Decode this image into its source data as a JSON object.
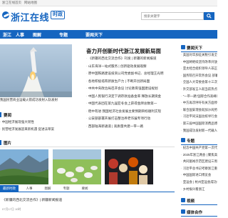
{
  "topbar": {
    "left": "浙江在线首页",
    "left2": "网站地图"
  },
  "header": {
    "logo": "浙江在线",
    "badge": "时政",
    "search_placeholder": "搜索关键字"
  },
  "nav": {
    "items": [
      "浙江",
      "人事",
      "图解",
      "专题",
      "要闻天下"
    ]
  },
  "feature": {
    "headline": "奋力开创新时代浙江发展新局面",
    "caption": "我国民营商业运载火箭成功发射入轨发射",
    "list": [
      "《新疆的西北交流合作》刊发 | 新疆的新闻报道",
      "山东海洋一站式服务 | 创新驱动发展观察",
      "原中国铁路建设投资公司党委副书记、总经理王光明",
      "各地积极培育新质生产力 | 不断开创新局面",
      "中共中央政治局召开会议 讨论教育强国建设规划",
      "中国人民银行决定下调存款准备金率 释放长期资金",
      "中国代表团在第九届亚冬会上获得金牌总数第一",
      "稳中有进 我国经济社会发展主要预期目标顺利实现",
      "公安部部署开展打击整治养老诈骗专项行动",
      "西部陆海新通道 | 高质量共建一带一路"
    ]
  },
  "focus": {
    "title": "要闻",
    "list": [
      "中国经济展现强大韧性",
      "民营经济发展迎来新机遇 促进法草案"
    ]
  },
  "gallery": {
    "title": "图片"
  },
  "tabs": {
    "items": [
      "最新时政",
      "人事",
      "图解",
      "专题",
      "要闻"
    ]
  },
  "bottom_news": {
    "headline": "《新疆的西北交流合作》| 新疆新闻报道",
    "date": "07月17日 10时"
  },
  "sidebar": {
    "hot_title": "要闻天下",
    "hot_list": [
      "美国对华加征关税引发全球市场震荡",
      "中国将继续坚持改革开放 欢迎各国企业来华投资",
      "亚太经合组织领导人非正式会议在秘鲁举行",
      "国务院召开常务会议 部署推动经济持续回升向好",
      "全国人大常委会第十三次会议闭幕",
      "外交部发言人就当前热点问题答记者问",
      "\"一带一路\"国际合作高峰论坛成果丰硕",
      "中方再次呼吁有关方面停火止战",
      "联合国安理会就加沙局势举行紧急会议",
      "习近平同法国总统举行会谈",
      "第三届中国国际消费品博览会开幕",
      "我国成功发射新一代载人飞船试验船"
    ],
    "special_title": "专题",
    "special_list": [
      "纪念中国共产党第一次代表大会召开",
      "2025年浙江两会 | 聚焦高质量发展",
      "共同富裕示范区建设三周年",
      "习近平总书记考察浙江重要讲话精神",
      "中国国际进口博览会",
      "亚运会 | 杭州亚运会成功举办",
      "乡村振兴看浙江",
      "数字化改革进行时"
    ],
    "video_title": "视频",
    "more_title": "媒体合作"
  }
}
